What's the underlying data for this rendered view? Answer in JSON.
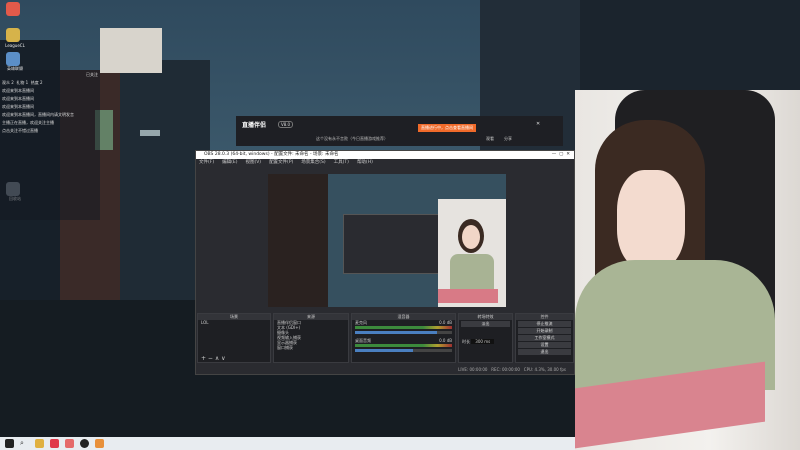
{
  "desktop": {
    "icons": [
      {
        "label": "LeagueCL"
      },
      {
        "label": "英雄联盟"
      },
      {
        "label": "回收站"
      }
    ]
  },
  "chat": {
    "header": "已关注",
    "stats": [
      "观众 2",
      "礼物 1",
      "热度 2"
    ],
    "messages": [
      "欢迎来到本直播间",
      "欢迎来到本直播间",
      "欢迎来到本直播间",
      "欢迎来到本直播间，直播间内请文明发言",
      "主播正在直播，欢迎关注主播",
      "点击关注不错过直播"
    ]
  },
  "streamer_app": {
    "logo": "直播伴侣",
    "version": "V8.0",
    "room_title": "这个没有永不言败（今日直播游戏推荐）",
    "notice": "直播进行中，点击查看直播间",
    "actions": [
      "观看",
      "分享"
    ]
  },
  "obs": {
    "title": "OBS 28.0.3 (64-bit, windows) - 配置文件: 未命名 - 场景: 未命名",
    "menu": [
      "文件(F)",
      "编辑(E)",
      "视图(V)",
      "配置文件(P)",
      "场景集合(S)",
      "工具(T)",
      "帮助(H)"
    ],
    "docks": {
      "scenes": "场景",
      "sources": "来源",
      "mixer": "混音器",
      "transitions": "转场特效",
      "controls": "控件"
    },
    "scenes": [
      "LOL"
    ],
    "sources": [
      "直播伴侣窗口",
      "文本 (GDI+)",
      "摄像头",
      "视频输入捕获",
      "显示器捕获",
      "窗口捕获"
    ],
    "mixer": [
      {
        "name": "麦克风",
        "db": "0.0 dB",
        "level": 0.85
      },
      {
        "name": "桌面音频",
        "db": "0.0 dB",
        "level": 0.6
      }
    ],
    "transition": {
      "type": "淡出",
      "duration_label": "时长",
      "duration": "300 ms"
    },
    "controls": [
      "停止推流",
      "开始录制",
      "工作室模式",
      "设置",
      "退出"
    ],
    "status": [
      "LIVE: 00:00:00",
      "REC: 00:00:00",
      "CPU: 4.3%, 30.00 fps"
    ]
  }
}
